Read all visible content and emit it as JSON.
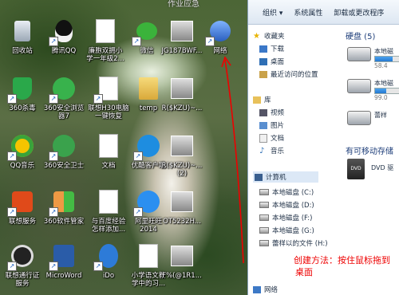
{
  "desktop": {
    "top_text": "作业应急",
    "icons": [
      {
        "label": "回收站",
        "icon": "recycle-bin-icon",
        "shortcut": false
      },
      {
        "label": "腾讯QQ",
        "icon": "qq-penguin-icon",
        "shortcut": true
      },
      {
        "label": "廉胞双拥小\n学一年级2...",
        "icon": "word-document-icon",
        "shortcut": false
      },
      {
        "label": "微信",
        "icon": "wechat-icon",
        "shortcut": true
      },
      {
        "label": "JG187BWF...",
        "icon": "image-file-icon",
        "shortcut": false
      },
      {
        "label": "网络",
        "icon": "network-icon",
        "shortcut": true
      },
      {
        "label": "360杀毒",
        "icon": "360-antivirus-icon",
        "shortcut": true
      },
      {
        "label": "360安全浏览\n器7",
        "icon": "360-browser-icon",
        "shortcut": true
      },
      {
        "label": "联想H30电脑\n一键恢复",
        "icon": "document-file-icon",
        "shortcut": true
      },
      {
        "label": "temp",
        "icon": "folder-icon",
        "shortcut": false
      },
      {
        "label": "R($KZU)~...",
        "icon": "image-file-icon",
        "shortcut": false
      },
      {
        "label": "QQ音乐",
        "icon": "qq-music-icon",
        "shortcut": true
      },
      {
        "label": "360安全卫士",
        "icon": "360-security-icon",
        "shortcut": true
      },
      {
        "label": "文档",
        "icon": "text-document-icon",
        "shortcut": false
      },
      {
        "label": "优酷客户端",
        "icon": "youku-icon",
        "shortcut": true
      },
      {
        "label": "R($KZU)~...\n(2)",
        "icon": "image-file-icon",
        "shortcut": false
      },
      {
        "label": "联想服务",
        "icon": "lenovo-service-icon",
        "shortcut": true
      },
      {
        "label": "360软件管家",
        "icon": "360-software-icon",
        "shortcut": true
      },
      {
        "label": "与百度经验\n怎样添加...",
        "icon": "word-document-icon",
        "shortcut": false
      },
      {
        "label": "阿里旺旺\n2014",
        "icon": "aliwangwang-icon",
        "shortcut": true
      },
      {
        "label": "OT5232H...",
        "icon": "image-file-icon",
        "shortcut": false
      },
      {
        "label": "联想通行证\n服务",
        "icon": "lenovo-passport-icon",
        "shortcut": true
      },
      {
        "label": "MicroWord",
        "icon": "ms-word-icon",
        "shortcut": true
      },
      {
        "label": "iDo",
        "icon": "ido-icon",
        "shortcut": true
      },
      {
        "label": "小学语文教\n学中的习...",
        "icon": "word-document-icon",
        "shortcut": false
      },
      {
        "label": "F%(@1R1...",
        "icon": "image-file-icon",
        "shortcut": false
      }
    ]
  },
  "explorer": {
    "toolbar": {
      "organize": "组织 ▾",
      "system_props": "系统属性",
      "uninstall": "卸载或更改程序"
    },
    "nav": {
      "favorites": "收藏夹",
      "downloads": "下载",
      "desktop": "桌面",
      "recent": "最近访问的位置",
      "libraries": "库",
      "videos": "视频",
      "pictures": "图片",
      "documents": "文档",
      "music": "音乐",
      "computer": "计算机",
      "drives": [
        "本地磁盘 (C:)",
        "本地磁盘 (D:)",
        "本地磁盘 (F:)",
        "本地磁盘 (G:)",
        "蕾样以的文件 (H:)"
      ],
      "network": "网络"
    },
    "right": {
      "hdd_header": "硬盘 (5)",
      "disks": [
        {
          "name": "本地磁",
          "sub": "58.4",
          "fill": 0.55
        },
        {
          "name": "本地磁",
          "sub": "99.0",
          "fill": 0.35
        },
        {
          "name": "蕾样",
          "sub": "",
          "fill": 0.0
        }
      ],
      "removable_header": "有可移动存储",
      "dvd": "DVD 驱"
    }
  },
  "annotation": {
    "line1": "创建方法：按住鼠标拖到",
    "line2": "桌面"
  },
  "colors": {
    "accent": "#1e3e7a",
    "annotation": "#e00000"
  }
}
